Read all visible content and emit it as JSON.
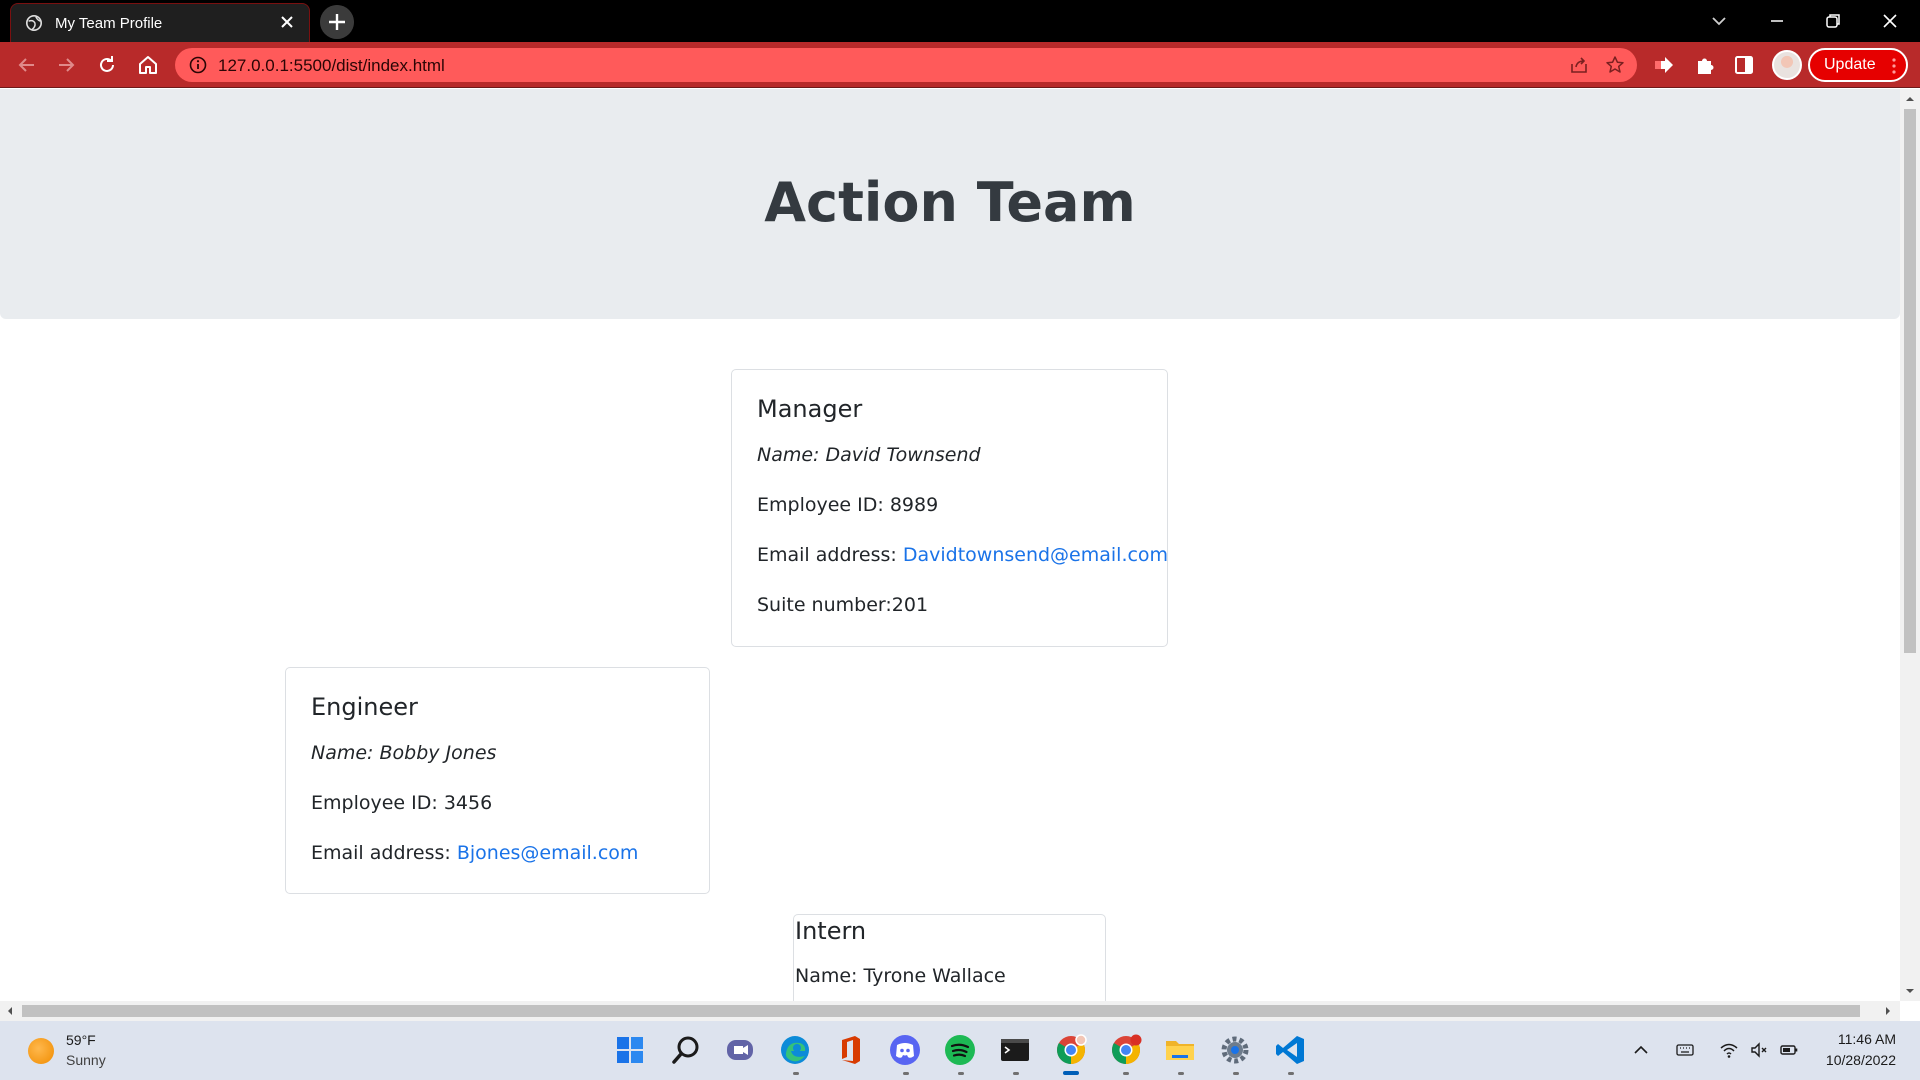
{
  "browser": {
    "tab_title": "My Team Profile",
    "url": "127.0.0.1:5500/dist/index.html",
    "update_label": "Update"
  },
  "page": {
    "title": "Action Team",
    "manager": {
      "heading": "Manager",
      "name": "Name: David Townsend",
      "id": "Employee ID: 8989",
      "email_label": "Email address: ",
      "email": "Davidtownsend@email.com",
      "office": "Suite number:201"
    },
    "engineer": {
      "heading": "Engineer",
      "name": "Name: Bobby Jones",
      "id": "Employee ID: 3456",
      "email_label": "Email address: ",
      "email": "Bjones@email.com"
    },
    "intern": {
      "heading": "Intern",
      "name": "Name: Tyrone Wallace"
    }
  },
  "taskbar": {
    "weather_temp": "59°F",
    "weather_desc": "Sunny",
    "time": "11:46 AM",
    "date": "10/28/2022"
  },
  "colors": {
    "toolbar": "#b82a2a",
    "omnibox": "#ff5a5a",
    "update_button": "#e60000",
    "jumbotron": "#e9ecef",
    "link": "#1a73e8"
  }
}
